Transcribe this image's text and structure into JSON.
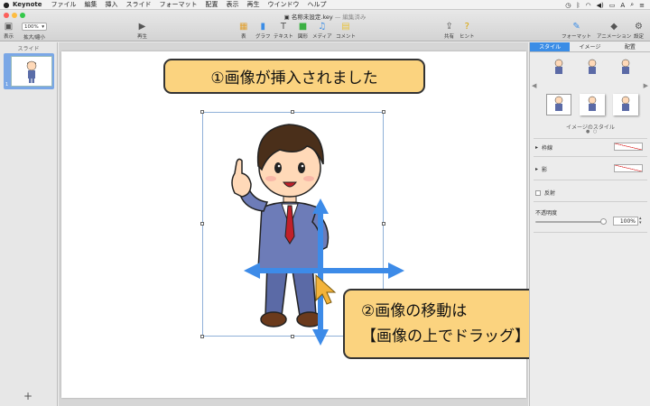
{
  "menubar": {
    "app": "Keynote",
    "items": [
      "ファイル",
      "編集",
      "挿入",
      "スライド",
      "フォーマット",
      "配置",
      "表示",
      "再生",
      "ウインドウ",
      "ヘルプ"
    ]
  },
  "window": {
    "title": "名称未設定.key",
    "edited": "— 編集済み"
  },
  "toolbar": {
    "view_label": "表示",
    "zoom_value": "100%",
    "zoom_label": "拡大/縮小",
    "play_label": "再生",
    "table_label": "表",
    "chart_label": "グラフ",
    "text_label": "テキスト",
    "shape_label": "図形",
    "media_label": "メディア",
    "comment_label": "コメント",
    "share_label": "共有",
    "tips_label": "ヒント",
    "format_label": "フォーマット",
    "animate_label": "アニメーション",
    "document_label": "設定"
  },
  "sidebar": {
    "header": "スライド",
    "slide_number": "1",
    "add": "+"
  },
  "slide": {
    "callout1": "①画像が挿入されました",
    "callout2_line1": "②画像の移動は",
    "callout2_line2": "【画像の上でドラッグ】"
  },
  "inspector": {
    "tabs": [
      "スタイル",
      "イメージ",
      "配置"
    ],
    "image_styles_label": "イメージのスタイル",
    "page_dots": "● ○",
    "border_label": "枠線",
    "shadow_label": "影",
    "reflection_label": "反射",
    "opacity_label": "不透明度",
    "opacity_value": "100%"
  },
  "colors": {
    "accent": "#3b8de6",
    "callout_fill": "#fbd37f",
    "arrow": "#3d8be8"
  }
}
